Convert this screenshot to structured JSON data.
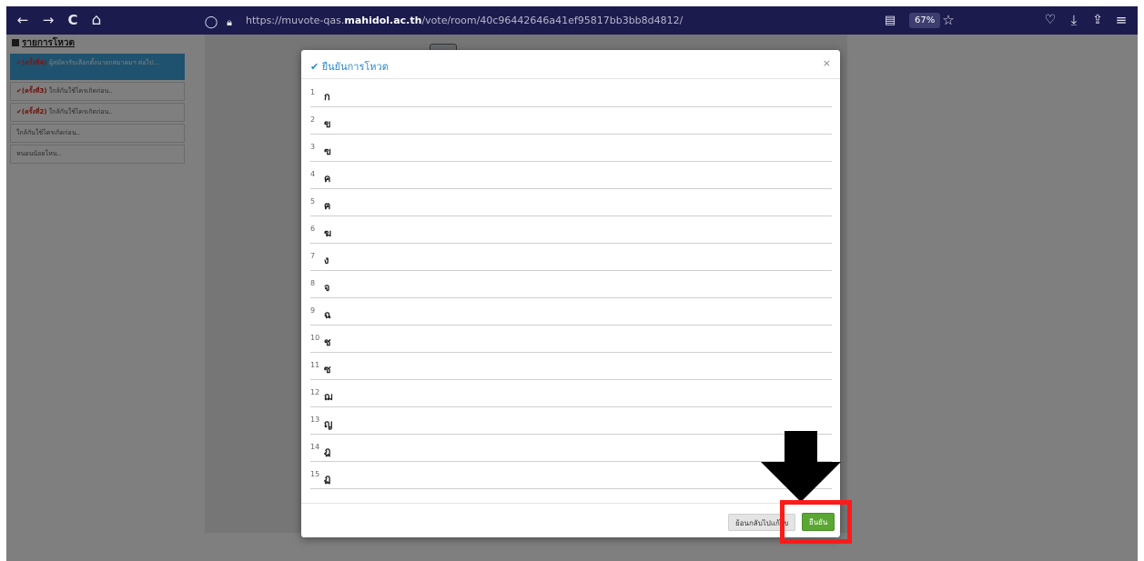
{
  "browser": {
    "back_icon": "←",
    "forward_icon": "→",
    "reload_icon": "C",
    "home_icon": "⌂",
    "shield_icon": "◯",
    "lock_icon": "🔒︎",
    "url_prefix": "https://muvote-qas.",
    "url_domain": "mahidol.ac.th",
    "url_path": "/vote/room/40c96442646a41ef95817bb3bb8d4812/",
    "reader_icon": "▤",
    "zoom": "67%",
    "star_icon": "☆",
    "pocket_icon": "♡",
    "download_icon": "⤓",
    "extensions_icon": "⇪",
    "menu_icon": "≡"
  },
  "sidebar": {
    "title": "รายการโหวต",
    "items": [
      {
        "prefix": "(ครั้งที่4)",
        "text": " ผู้สมัครรับเลือกตั้งนายกสมาคมฯ ต่อไป...",
        "active": true
      },
      {
        "prefix": "(ครั้งที่3)",
        "text": " ใกล้กันใช้ไครเกิดก่อน..",
        "active": false
      },
      {
        "prefix": "(ครั้งที่2)",
        "text": " ใกล้กันใช้ไครเกิดก่อน..",
        "active": false
      },
      {
        "prefix": "",
        "text": "ใกล้กันใช้ไครเกิดก่อน..",
        "active": false
      },
      {
        "prefix": "",
        "text": "หนอนน้อยโหน..",
        "active": false
      }
    ]
  },
  "modal": {
    "title": "ยืนยันการโหวต",
    "close_label": "×",
    "rows": [
      {
        "num": "1",
        "label": "ก"
      },
      {
        "num": "2",
        "label": "ข"
      },
      {
        "num": "3",
        "label": "ฃ"
      },
      {
        "num": "4",
        "label": "ค"
      },
      {
        "num": "5",
        "label": "ฅ"
      },
      {
        "num": "6",
        "label": "ฆ"
      },
      {
        "num": "7",
        "label": "ง"
      },
      {
        "num": "8",
        "label": "จ"
      },
      {
        "num": "9",
        "label": "ฉ"
      },
      {
        "num": "10",
        "label": "ช"
      },
      {
        "num": "11",
        "label": "ซ"
      },
      {
        "num": "12",
        "label": "ฌ"
      },
      {
        "num": "13",
        "label": "ญ"
      },
      {
        "num": "14",
        "label": "ฎ"
      },
      {
        "num": "15",
        "label": "ฏ"
      }
    ],
    "back_label": "ย้อนกลับไปแก้ไข",
    "confirm_label": "ยืนยัน"
  },
  "colors": {
    "browser_bar": "#1c1b4e",
    "highlight": "#ff1a1a",
    "confirm": "#5aa733",
    "title_accent": "#2a8ac8"
  }
}
